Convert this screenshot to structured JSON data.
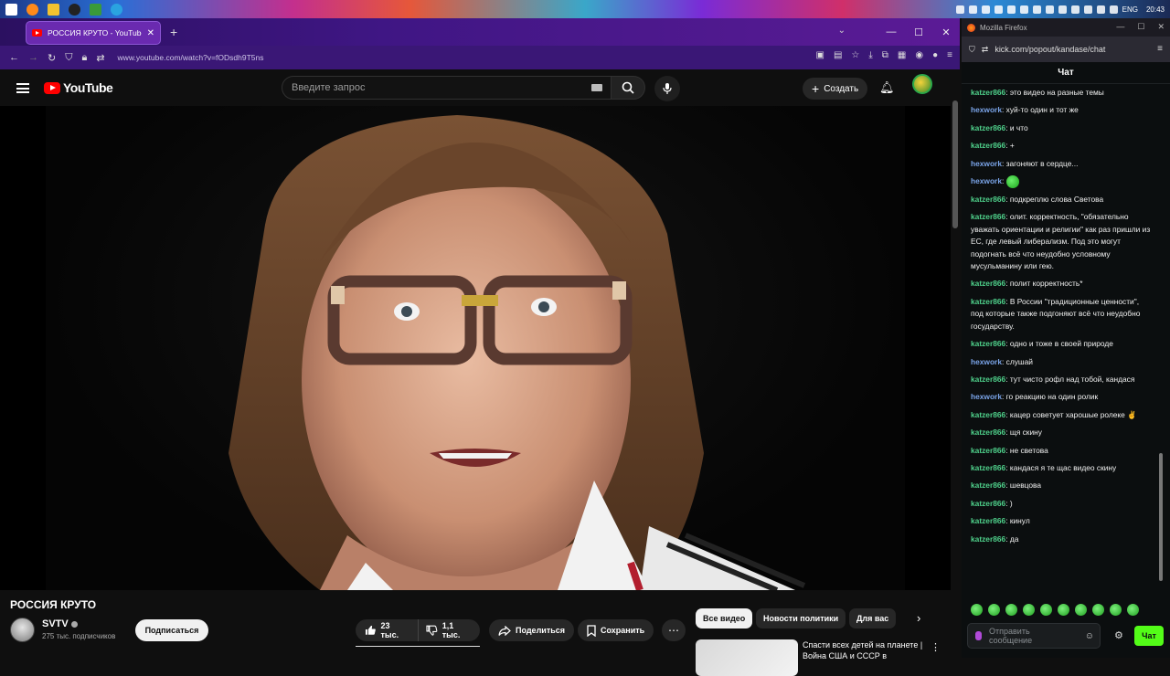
{
  "taskbar": {
    "lang": "ENG",
    "time": "20:43"
  },
  "browser": {
    "tab_title": "РОССИЯ КРУТО - YouTube",
    "url": "www.youtube.com/watch?v=fODsdh9T5ns"
  },
  "youtube": {
    "logo": "YouTube",
    "search_placeholder": "Введите запрос",
    "create_label": "Создать",
    "video": {
      "title": "РОССИЯ КРУТО",
      "channel": "SVTV",
      "subscribers": "275 тыс. подписчиков",
      "subscribe_label": "Подписаться",
      "likes": "23 тыс.",
      "dislikes": "1,1 тыс.",
      "share_label": "Поделиться",
      "save_label": "Сохранить"
    },
    "chips": [
      "Все видео",
      "Новости политики",
      "Для вас"
    ],
    "rec_title": "Спасти всех детей на планете | Война США и СССР в"
  },
  "chat_window": {
    "title": "Mozilla Firefox",
    "url": "kick.com/popout/kandase/chat",
    "header": "Чат",
    "input_placeholder": "Отправить сообщение",
    "send_label": "Чат",
    "messages": [
      {
        "user": "katzer866",
        "text": "это видео на разные темы"
      },
      {
        "user": "hexwork",
        "text": "хуй-то один и тот же"
      },
      {
        "user": "katzer866",
        "text": "и что"
      },
      {
        "user": "katzer866",
        "text": "+"
      },
      {
        "user": "hexwork",
        "text": "загоняют в сердце..."
      },
      {
        "user": "hexwork",
        "text": ""
      },
      {
        "user": "katzer866",
        "text": "подкреплю слова Светова"
      },
      {
        "user": "katzer866",
        "text": "олит. корректность, \"обязательно уважать ориентации и религии\" как раз пришли из ЕС, где левый либерализм. Под это могут подогнать всё что неудобно условному мусульманину или гею."
      },
      {
        "user": "katzer866",
        "text": "полит корректность*"
      },
      {
        "user": "katzer866",
        "text": "В России \"традиционные ценности\", под которые также подгоняют всё что неудобно государству."
      },
      {
        "user": "katzer866",
        "text": "одно и тоже в своей природе"
      },
      {
        "user": "hexwork",
        "text": "слушай"
      },
      {
        "user": "katzer866",
        "text": "тут чисто рофл над тобой, кандася"
      },
      {
        "user": "hexwork",
        "text": "го реакцию на один ролик"
      },
      {
        "user": "katzer866",
        "text": "кацер советует харошые ролеке ✌"
      },
      {
        "user": "katzer866",
        "text": "щя скину"
      },
      {
        "user": "katzer866",
        "text": "не светова"
      },
      {
        "user": "katzer866",
        "text": "кандася я те щас видео скину"
      },
      {
        "user": "katzer866",
        "text": "шевцова"
      },
      {
        "user": "katzer866",
        "text": ")"
      },
      {
        "user": "katzer866",
        "text": "кинул"
      },
      {
        "user": "katzer866",
        "text": "да"
      }
    ]
  },
  "colors": {
    "kick_green": "#53fc18",
    "yt_red": "#ff0000",
    "user_katzer": "#4fd18b",
    "user_hexwork": "#7aa4e8"
  }
}
